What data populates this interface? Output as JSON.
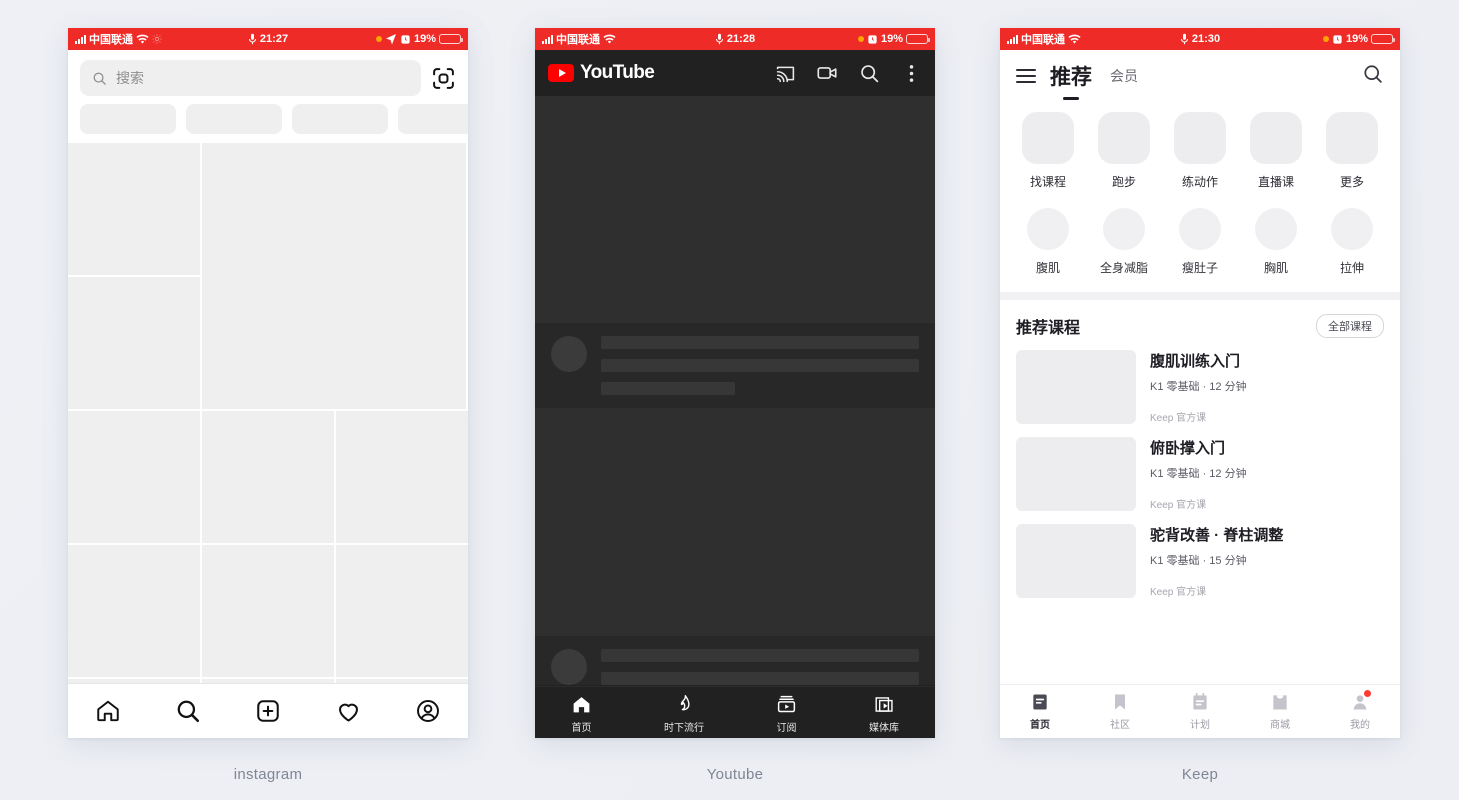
{
  "captions": {
    "instagram": "instagram",
    "youtube": "Youtube",
    "keep": "Keep"
  },
  "colors": {
    "status_bar_red": "#ef2b27",
    "youtube_red": "#ff0000",
    "page_bg": "#eef0f5",
    "skeleton_gray": "#efefef",
    "keep_badge_red": "#ff3b30"
  },
  "instagram": {
    "status": {
      "carrier": "中国联通",
      "time": "21:27",
      "battery": "19%"
    },
    "search": {
      "placeholder": "搜索",
      "icon": "search-icon",
      "scan_icon": "scan-code-icon"
    },
    "chips": [
      "",
      "",
      "",
      ""
    ],
    "tabs": [
      {
        "name": "home",
        "icon": "home-icon"
      },
      {
        "name": "search",
        "icon": "search-icon"
      },
      {
        "name": "create",
        "icon": "plus-square-icon"
      },
      {
        "name": "activity",
        "icon": "heart-icon"
      },
      {
        "name": "profile",
        "icon": "profile-circle-icon"
      }
    ]
  },
  "youtube": {
    "status": {
      "carrier": "中国联通",
      "time": "21:28",
      "battery": "19%"
    },
    "brand": "YouTube",
    "header_icons": [
      {
        "name": "cast",
        "icon": "cast-icon"
      },
      {
        "name": "camera",
        "icon": "video-camera-icon"
      },
      {
        "name": "search",
        "icon": "search-icon"
      },
      {
        "name": "more",
        "icon": "more-vertical-icon"
      }
    ],
    "tabs": [
      {
        "label": "首页",
        "icon": "home-icon"
      },
      {
        "label": "时下流行",
        "icon": "flame-icon"
      },
      {
        "label": "订阅",
        "icon": "subscriptions-icon"
      },
      {
        "label": "媒体库",
        "icon": "library-icon"
      }
    ]
  },
  "keep": {
    "status": {
      "carrier": "中国联通",
      "time": "21:30",
      "battery": "19%"
    },
    "header": {
      "menu_icon": "hamburger-menu-icon",
      "active_tab": "推荐",
      "tab": "会员",
      "search_icon": "search-icon"
    },
    "grid_row1": [
      "找课程",
      "跑步",
      "练动作",
      "直播课",
      "更多"
    ],
    "grid_row2": [
      "腹肌",
      "全身减脂",
      "瘦肚子",
      "胸肌",
      "拉伸"
    ],
    "courses_section": {
      "title": "推荐课程",
      "all_button": "全部课程",
      "items": [
        {
          "name": "腹肌训练入门",
          "meta": "K1 零基础 · 12 分钟",
          "tag": "Keep 官方课"
        },
        {
          "name": "俯卧撑入门",
          "meta": "K1 零基础 · 12 分钟",
          "tag": "Keep 官方课"
        },
        {
          "name": "驼背改善 · 脊柱调整",
          "meta": "K1 零基础 · 15 分钟",
          "tag": "Keep 官方课"
        }
      ]
    },
    "tabs": [
      {
        "label": "首页",
        "icon": "home-doc-icon",
        "active": true,
        "badge": false
      },
      {
        "label": "社区",
        "icon": "bookmark-icon",
        "active": false,
        "badge": false
      },
      {
        "label": "计划",
        "icon": "clipboard-icon",
        "active": false,
        "badge": false
      },
      {
        "label": "商城",
        "icon": "bag-icon",
        "active": false,
        "badge": false
      },
      {
        "label": "我的",
        "icon": "person-icon",
        "active": false,
        "badge": true
      }
    ]
  }
}
